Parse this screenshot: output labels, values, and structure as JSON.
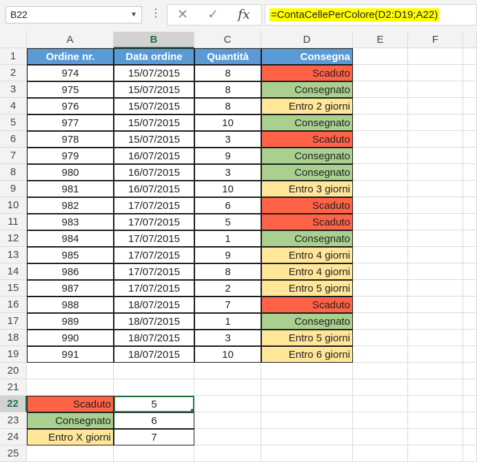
{
  "name_box": "B22",
  "formula": "=ContaCellePerColore(D2:D19;A22)",
  "columns": [
    "A",
    "B",
    "C",
    "D",
    "E",
    "F"
  ],
  "headers": [
    "Ordine nr.",
    "Data ordine",
    "Quantità",
    "Consegna"
  ],
  "rows": [
    {
      "num": "2",
      "a": "974",
      "b": "15/07/2015",
      "c": "8",
      "d": "Scaduto",
      "color": "red"
    },
    {
      "num": "3",
      "a": "975",
      "b": "15/07/2015",
      "c": "8",
      "d": "Consegnato",
      "color": "green"
    },
    {
      "num": "4",
      "a": "976",
      "b": "15/07/2015",
      "c": "8",
      "d": "Entro 2 giorni",
      "color": "yellow"
    },
    {
      "num": "5",
      "a": "977",
      "b": "15/07/2015",
      "c": "10",
      "d": "Consegnato",
      "color": "green"
    },
    {
      "num": "6",
      "a": "978",
      "b": "15/07/2015",
      "c": "3",
      "d": "Scaduto",
      "color": "red"
    },
    {
      "num": "7",
      "a": "979",
      "b": "16/07/2015",
      "c": "9",
      "d": "Consegnato",
      "color": "green"
    },
    {
      "num": "8",
      "a": "980",
      "b": "16/07/2015",
      "c": "3",
      "d": "Consegnato",
      "color": "green"
    },
    {
      "num": "9",
      "a": "981",
      "b": "16/07/2015",
      "c": "10",
      "d": "Entro 3 giorni",
      "color": "yellow"
    },
    {
      "num": "10",
      "a": "982",
      "b": "17/07/2015",
      "c": "6",
      "d": "Scaduto",
      "color": "red"
    },
    {
      "num": "11",
      "a": "983",
      "b": "17/07/2015",
      "c": "5",
      "d": "Scaduto",
      "color": "red"
    },
    {
      "num": "12",
      "a": "984",
      "b": "17/07/2015",
      "c": "1",
      "d": "Consegnato",
      "color": "green"
    },
    {
      "num": "13",
      "a": "985",
      "b": "17/07/2015",
      "c": "9",
      "d": "Entro 4 giorni",
      "color": "yellow"
    },
    {
      "num": "14",
      "a": "986",
      "b": "17/07/2015",
      "c": "8",
      "d": "Entro 4 giorni",
      "color": "yellow"
    },
    {
      "num": "15",
      "a": "987",
      "b": "17/07/2015",
      "c": "2",
      "d": "Entro 5 giorni",
      "color": "yellow"
    },
    {
      "num": "16",
      "a": "988",
      "b": "18/07/2015",
      "c": "7",
      "d": "Scaduto",
      "color": "red"
    },
    {
      "num": "17",
      "a": "989",
      "b": "18/07/2015",
      "c": "1",
      "d": "Consegnato",
      "color": "green"
    },
    {
      "num": "18",
      "a": "990",
      "b": "18/07/2015",
      "c": "3",
      "d": "Entro 5 giorni",
      "color": "yellow"
    },
    {
      "num": "19",
      "a": "991",
      "b": "18/07/2015",
      "c": "10",
      "d": "Entro 6 giorni",
      "color": "yellow"
    }
  ],
  "summary": [
    {
      "num": "22",
      "label": "Scaduto",
      "value": "5",
      "color": "red"
    },
    {
      "num": "23",
      "label": "Consegnato",
      "value": "6",
      "color": "green"
    },
    {
      "num": "24",
      "label": "Entro X giorni",
      "value": "7",
      "color": "yellow"
    }
  ],
  "empty_rows": [
    "20",
    "21",
    "25"
  ],
  "header_row_num": "1",
  "colors": {
    "header": "#5b9bd5",
    "red": "#ff6347",
    "green": "#a9d08e",
    "yellow": "#ffe699",
    "selection": "#217346",
    "formula_highlight": "#ffff00"
  }
}
